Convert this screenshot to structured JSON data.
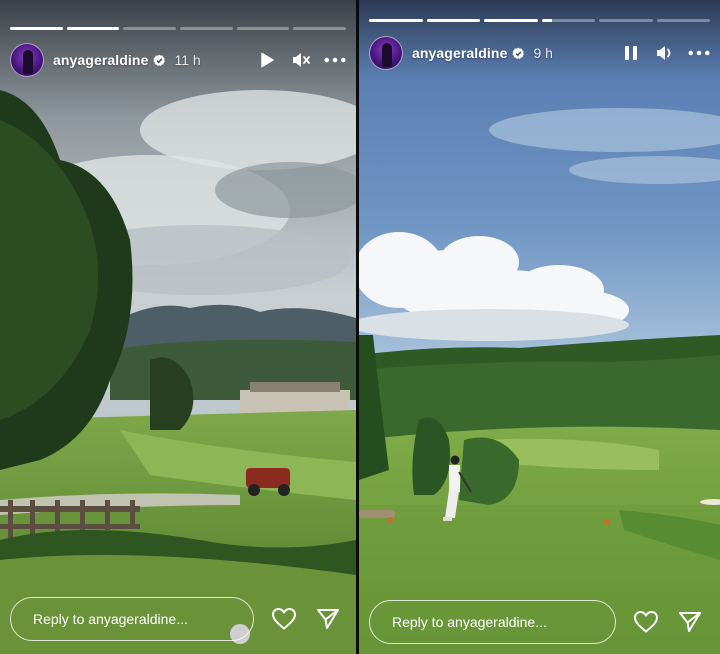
{
  "stories": [
    {
      "username": "anyageraldine",
      "time": "11 h",
      "progress": [
        1,
        1,
        0,
        0,
        0,
        0
      ],
      "reply_placeholder": "Reply to anyageraldine...",
      "controls": [
        "play-icon",
        "mute-icon",
        "more-icon"
      ]
    },
    {
      "username": "anyageraldine",
      "time": "9 h",
      "progress": [
        1,
        1,
        1,
        0.2,
        0,
        0
      ],
      "reply_placeholder": "Reply to anyageraldine...",
      "controls": [
        "pause-icon",
        "volume-icon",
        "more-icon"
      ]
    }
  ],
  "colors": {
    "verified": "#ffffff",
    "sky_left": "#c9d1d6",
    "sky_right": "#6f94c4",
    "grass": "#6f9b3e"
  }
}
